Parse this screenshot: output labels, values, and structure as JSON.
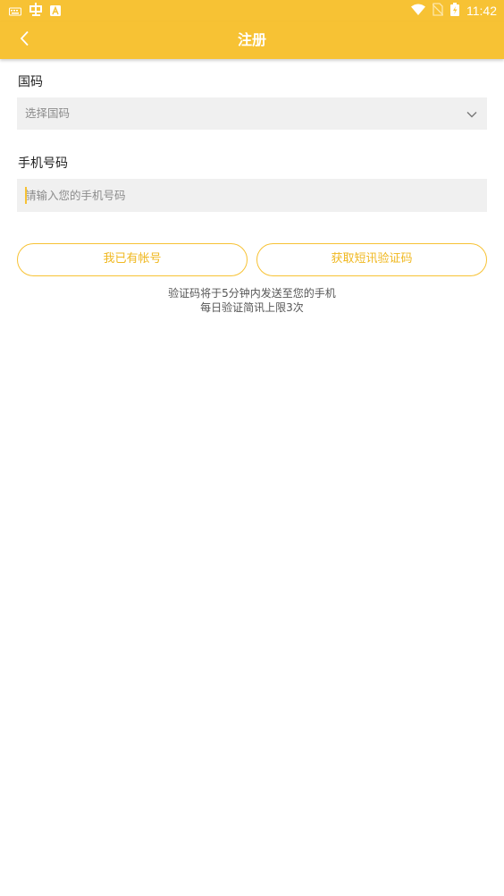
{
  "status_bar": {
    "time": "11:42",
    "icons": [
      "keyboard-icon",
      "app-notification-icon",
      "text-a-icon",
      "wifi-icon",
      "no-sim-icon",
      "battery-charging-icon"
    ]
  },
  "app_bar": {
    "title": "注册",
    "back_icon": "chevron-left-icon"
  },
  "form": {
    "country_label": "国码",
    "country_placeholder": "选择国码",
    "phone_label": "手机号码",
    "phone_placeholder": "請输入您的手机号码",
    "phone_value": ""
  },
  "buttons": {
    "have_account": "我已有帐号",
    "get_sms_code": "获取短讯验证码"
  },
  "hints": {
    "line1": "验证码将于5分钟内发送至您的手机",
    "line2": "每日验证简讯上限3次"
  },
  "colors": {
    "brand": "#f7c234",
    "button_text": "#f0b820",
    "field_bg": "#f0f0f0"
  }
}
